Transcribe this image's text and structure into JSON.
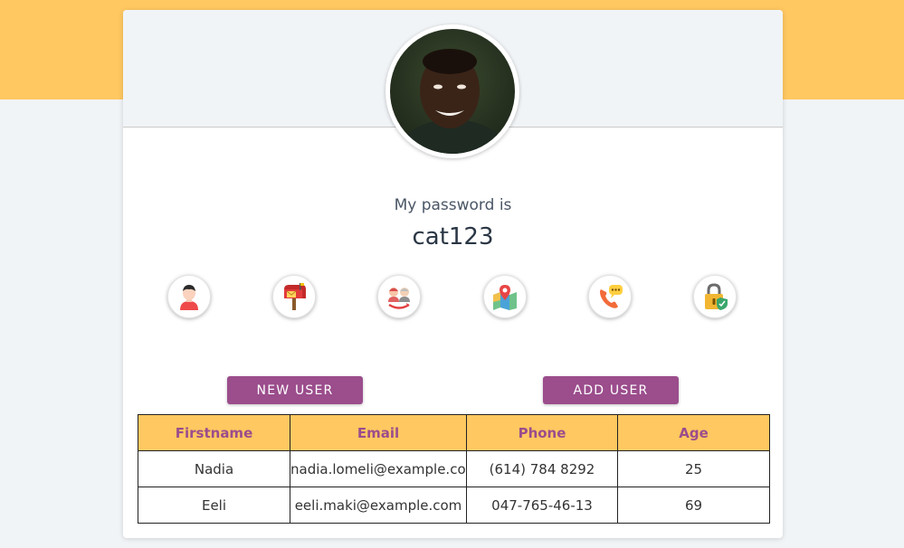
{
  "profile": {
    "label": "My password is",
    "value": "cat123"
  },
  "icons": [
    {
      "name": "user-icon"
    },
    {
      "name": "mailbox-icon"
    },
    {
      "name": "age-icon"
    },
    {
      "name": "map-icon"
    },
    {
      "name": "phone-icon"
    },
    {
      "name": "lock-icon"
    }
  ],
  "buttons": {
    "new_user": "NEW USER",
    "add_user": "ADD USER"
  },
  "table": {
    "headers": [
      "Firstname",
      "Email",
      "Phone",
      "Age"
    ],
    "rows": [
      [
        "Nadia",
        "nadia.lomeli@example.com",
        "(614) 784 8292",
        "25"
      ],
      [
        "Eeli",
        "eeli.maki@example.com",
        "047-765-46-13",
        "69"
      ]
    ]
  },
  "colors": {
    "accent": "#9b4d8c",
    "band": "#ffc861",
    "background": "#f1f4f7"
  }
}
